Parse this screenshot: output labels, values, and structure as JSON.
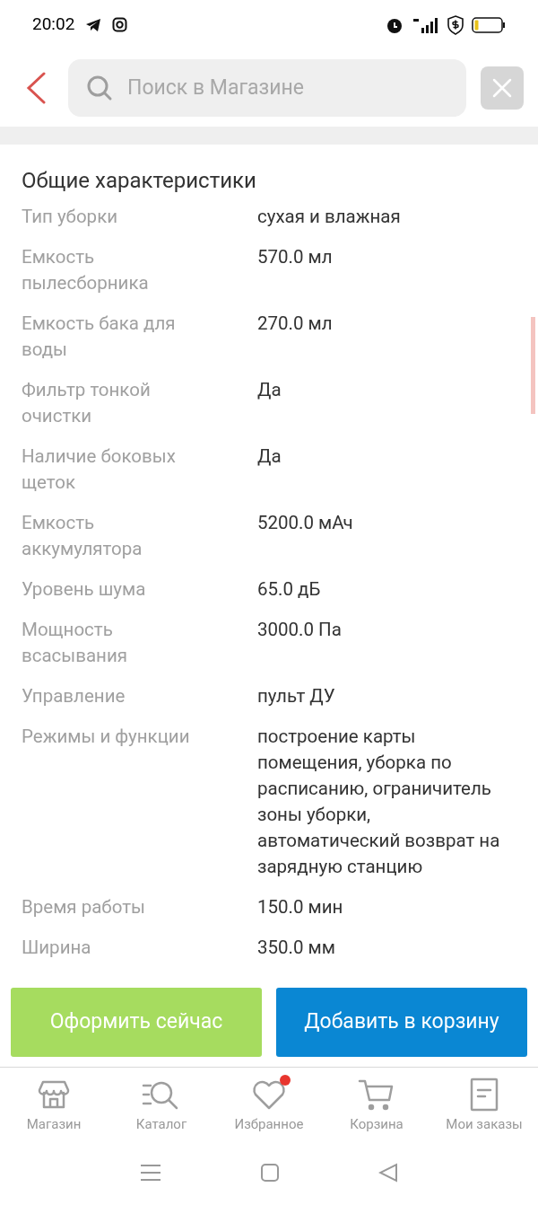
{
  "status_bar": {
    "time": "20:02"
  },
  "search": {
    "placeholder": "Поиск в Магазине"
  },
  "section": {
    "title": "Общие характеристики",
    "rows": [
      {
        "label": "Тип уборки",
        "value": "сухая и влажная"
      },
      {
        "label": "Емкость пылесборника",
        "value": "570.0 мл"
      },
      {
        "label": "Емкость бака для воды",
        "value": "270.0 мл"
      },
      {
        "label": "Фильтр тонкой очистки",
        "value": "Да"
      },
      {
        "label": "Наличие боковых щеток",
        "value": "Да"
      },
      {
        "label": "Емкость аккумулятора",
        "value": "5200.0 мАч"
      },
      {
        "label": "Уровень шума",
        "value": "65.0 дБ"
      },
      {
        "label": "Мощность всасывания",
        "value": "3000.0 Па"
      },
      {
        "label": "Управление",
        "value": "пульт ДУ"
      },
      {
        "label": "Режимы и функции",
        "value": "построение карты помещения, уборка по расписанию, ограничитель зоны уборки, автоматический возврат на зарядную станцию"
      },
      {
        "label": "Время работы",
        "value": "150.0 мин"
      },
      {
        "label": "Ширина",
        "value": "350.0 мм"
      }
    ]
  },
  "actions": [
    {
      "kind": "buy",
      "label": "Оформить сейчас"
    },
    {
      "kind": "cart",
      "label": "Добавить в корзину"
    }
  ],
  "bottom_nav": [
    {
      "kind": "shop",
      "label": "Магазин",
      "badge": false
    },
    {
      "kind": "catalog",
      "label": "Каталог",
      "badge": false
    },
    {
      "kind": "favorites",
      "label": "Избранное",
      "badge": true
    },
    {
      "kind": "cart",
      "label": "Корзина",
      "badge": false
    },
    {
      "kind": "orders",
      "label": "Мои заказы",
      "badge": false
    }
  ]
}
